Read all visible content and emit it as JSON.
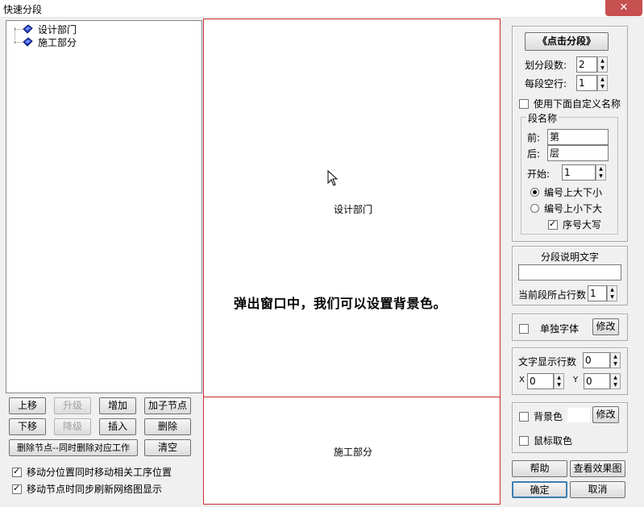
{
  "window": {
    "title": "快速分段",
    "close_label": "✕"
  },
  "tree": {
    "items": [
      "设计部门",
      "施工部分"
    ]
  },
  "left_buttons": {
    "up": "上移",
    "promote": "升级",
    "add": "增加",
    "add_child": "加子节点",
    "down": "下移",
    "demote": "降级",
    "insert": "插入",
    "delete": "删除",
    "delete_sync": "删除节点--同时删除对应工作",
    "clear": "清空"
  },
  "left_checks": {
    "move_sync": "移动分位置同时移动相关工序位置",
    "refresh_sync": "移动节点时同步刷新网络图显示"
  },
  "canvas": {
    "segment1": "设计部门",
    "segment2": "施工部分",
    "overlay_text": "弹出窗口中，我们可以设置背景色。"
  },
  "right": {
    "split_button": "《点击分段》",
    "seg_count_label": "划分段数:",
    "seg_count": "2",
    "blank_rows_label": "每段空行:",
    "blank_rows": "1",
    "use_custom_label": "使用下面自定义名称",
    "name_group": "段名称",
    "prefix_label": "前:",
    "prefix_value": "第",
    "suffix_label": "后:",
    "suffix_value": "层",
    "start_label": "开始:",
    "start_value": "1",
    "radio_top_big": "编号上大下小",
    "radio_top_small": "编号上小下大",
    "uppercase_label": "序号大写",
    "desc_title": "分段说明文字",
    "desc_value": "",
    "rows_label": "当前段所占行数",
    "rows_value": "1",
    "font_label": "单独字体",
    "modify1": "修改",
    "text_rows_label": "文字显示行数",
    "text_rows_value": "0",
    "x_label": "X",
    "x_value": "0",
    "y_label": "Y",
    "y_value": "0",
    "bg_label": "背景色",
    "modify2": "修改",
    "mouse_color_label": "鼠标取色",
    "help": "帮助",
    "preview": "查看效果图",
    "ok": "确定",
    "cancel": "取消"
  }
}
